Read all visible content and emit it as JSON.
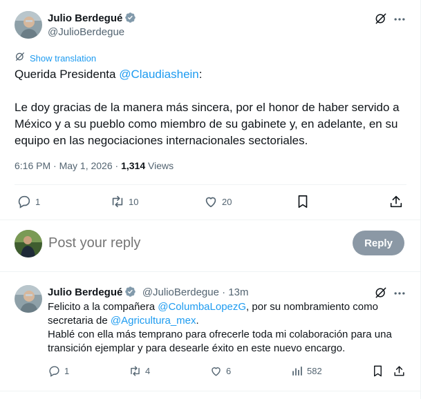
{
  "main_tweet": {
    "author_name": "Julio Berdegué",
    "author_handle": "@JulioBerdegue",
    "show_translation": "Show translation",
    "greeting_prefix": "Querida Presidenta ",
    "greeting_mention": "@Claudiashein",
    "greeting_suffix": ":",
    "body": "Le doy gracias de la manera más sincera, por el honor de haber servido a México y a su pueblo como miembro de su gabinete y, en adelante, en su equipo en las negociaciones internacionales sectoriales.",
    "time": "6:16 PM · May 1, 2026 · ",
    "views_count": "1,314",
    "views_label": " Views",
    "replies": "1",
    "retweets": "10",
    "likes": "20"
  },
  "reply_box": {
    "placeholder": "Post your reply",
    "button_label": "Reply"
  },
  "reply_tweet": {
    "author_name": "Julio Berdegué",
    "author_handle": "@JulioBerdegue",
    "separator": " · ",
    "age": "13m",
    "line1_prefix": "Felicito a la compañera ",
    "line1_mention": "@ColumbaLopezG",
    "line1_suffix": ", por su nombramiento como",
    "line2_prefix": "secretaria de ",
    "line2_mention": "@Agricultura_mex",
    "line2_suffix": ".",
    "line3": "Hablé con ella más temprano para ofrecerle toda mi colaboración para una transición ejemplar y para desearle éxito en este nuevo encargo.",
    "replies": "1",
    "retweets": "4",
    "likes": "6",
    "views": "582"
  },
  "icons": [
    "verified-badge-icon",
    "grok-icon",
    "more-icon",
    "translate-icon",
    "reply-icon",
    "retweet-icon",
    "like-icon",
    "bookmark-icon",
    "share-icon",
    "views-icon"
  ],
  "colors": {
    "link": "#1d9bf0",
    "secondary_text": "#536471",
    "primary_text": "#0f1419",
    "reply_button_bg": "#8b98a5"
  }
}
